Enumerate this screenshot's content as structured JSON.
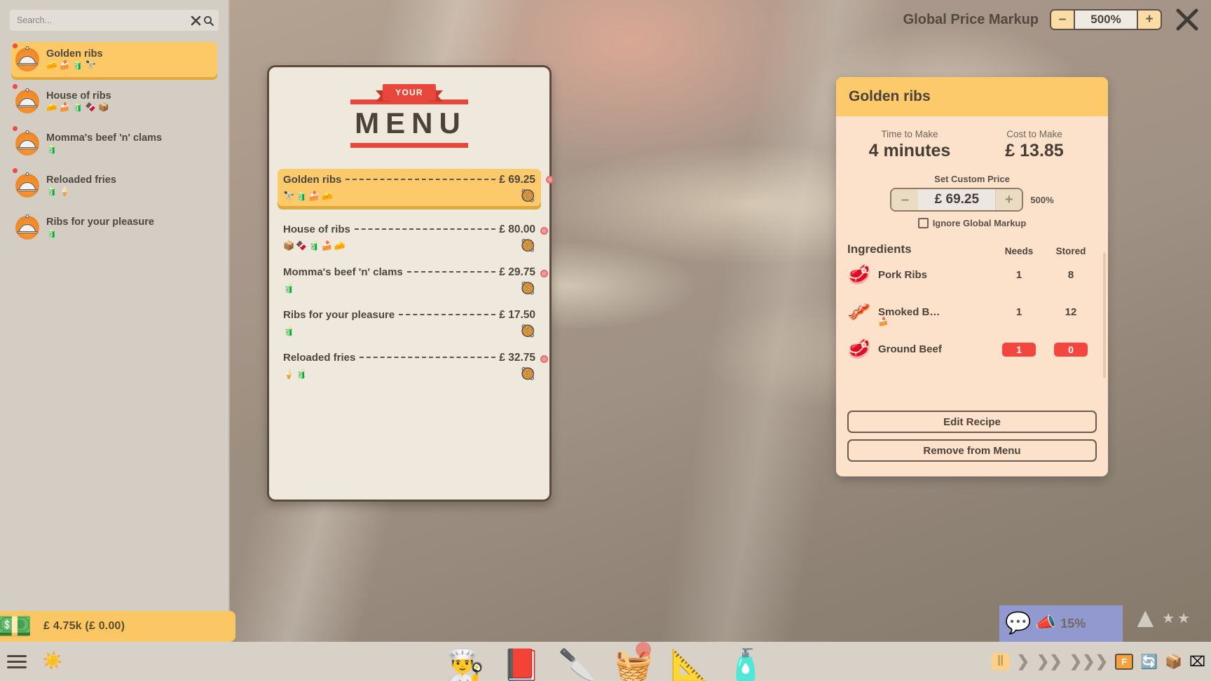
{
  "search": {
    "placeholder": "Search...",
    "value": "",
    "clear_icon": "close-icon",
    "search_icon": "search-icon"
  },
  "sidebar": {
    "dishes": [
      {
        "name": "Golden ribs",
        "tags": [
          "🧀",
          "🍰",
          "🧃",
          "🔭"
        ],
        "selected": true,
        "alert": true
      },
      {
        "name": "House of ribs",
        "tags": [
          "🧀",
          "🍰",
          "🧃",
          "🍫",
          "📦"
        ],
        "selected": false,
        "alert": true
      },
      {
        "name": "Momma's beef 'n' clams",
        "tags": [
          "🧃"
        ],
        "selected": false,
        "alert": true
      },
      {
        "name": "Reloaded fries",
        "tags": [
          "🧃",
          "🍦"
        ],
        "selected": false,
        "alert": true
      },
      {
        "name": "Ribs for your pleasure",
        "tags": [
          "🧃"
        ],
        "selected": false,
        "alert": false
      }
    ]
  },
  "money": {
    "icon": "cash-icon",
    "text": "£ 4.75k (£ 0.00)"
  },
  "topbar": {
    "markup_label": "Global Price Markup",
    "markup_value": "500%",
    "minus_label": "–",
    "plus_label": "+",
    "close_icon": "close-icon"
  },
  "menu_card": {
    "ribbon_text": "YOUR",
    "title": "MENU",
    "items": [
      {
        "name": "Golden ribs",
        "price": "£ 69.25",
        "tags": [
          "🔭",
          "🧃",
          "🍰",
          "🧀"
        ],
        "pan": "🥘",
        "selected": true,
        "bullet": true
      },
      {
        "name": "House of ribs",
        "price": "£ 80.00",
        "tags": [
          "📦",
          "🍫",
          "🧃",
          "🍰",
          "🧀"
        ],
        "pan": "🥘",
        "selected": false,
        "bullet": true
      },
      {
        "name": "Momma's beef 'n' clams",
        "price": "£ 29.75",
        "tags": [
          "🧃"
        ],
        "pan": "🥘",
        "selected": false,
        "bullet": true
      },
      {
        "name": "Ribs for your pleasure",
        "price": "£ 17.50",
        "tags": [
          "🧃"
        ],
        "pan": "🥘",
        "selected": false,
        "bullet": false
      },
      {
        "name": "Reloaded fries",
        "price": "£ 32.75",
        "tags": [
          "🍦",
          "🧃"
        ],
        "pan": "🥘",
        "selected": false,
        "bullet": true
      }
    ]
  },
  "detail": {
    "title": "Golden ribs",
    "time_label": "Time to Make",
    "time_value": "4 minutes",
    "cost_label": "Cost to Make",
    "cost_value": "£ 13.85",
    "custom_price_label": "Set Custom Price",
    "custom_price_value": "£ 69.25",
    "custom_price_minus": "–",
    "custom_price_plus": "+",
    "markup_percent": "500%",
    "ignore_markup_label": "Ignore Global Markup",
    "ignore_markup_checked": false,
    "table": {
      "col_ingredients": "Ingredients",
      "col_needs": "Needs",
      "col_stored": "Stored",
      "rows": [
        {
          "icon": "🥩",
          "name": "Pork Ribs",
          "subtag": "",
          "needs": "1",
          "stored": "8",
          "alert": false
        },
        {
          "icon": "🥓",
          "name": "Smoked B…",
          "subtag": "🍰",
          "needs": "1",
          "stored": "12",
          "alert": false
        },
        {
          "icon": "🥩",
          "name": "Ground Beef",
          "subtag": "",
          "needs": "1",
          "stored": "0",
          "alert": true
        }
      ]
    },
    "edit_recipe_label": "Edit Recipe",
    "remove_label": "Remove from Menu"
  },
  "bottombar": {
    "menu_icon": "hamburger-icon",
    "daylight_icon": "sun-icon",
    "tools": [
      {
        "icon": "👨‍🍳",
        "name": "staff-icon",
        "notify": false
      },
      {
        "icon": "📕",
        "name": "menu-book-icon",
        "notify": false
      },
      {
        "icon": "🔪",
        "name": "prep-board-icon",
        "notify": false
      },
      {
        "icon": "🧺",
        "name": "ingredients-icon",
        "notify": true
      },
      {
        "icon": "📐",
        "name": "build-icon",
        "notify": false
      },
      {
        "icon": "🧴",
        "name": "cleaning-icon",
        "notify": false
      }
    ],
    "speed": {
      "pause": "‖",
      "play": "❯",
      "fast": "❯❯",
      "fastest": "❯❯❯"
    },
    "fkey": "F",
    "right_icons": [
      "🔄",
      "📦",
      "⌧"
    ]
  },
  "announcement": {
    "bubble_icon": "alert-bubble-icon",
    "megaphone_icon": "megaphone-icon",
    "percent": "15%"
  },
  "colors": {
    "accent_yellow": "#fcc96b",
    "panel_cream": "#fce2cb",
    "menu_paper": "#efe8dd",
    "sidebar": "#d4cdc4",
    "red": "#e8483c",
    "alert_red": "#f4463f"
  }
}
